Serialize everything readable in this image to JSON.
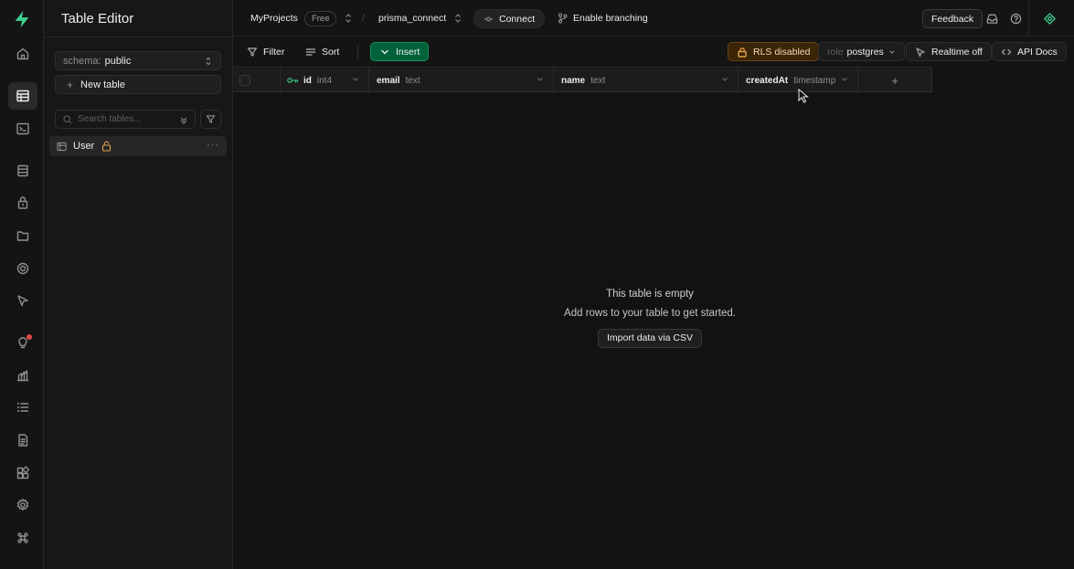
{
  "sidebar": {
    "title": "Table Editor",
    "schema_prefix": "schema:",
    "schema_value": "public",
    "new_table_label": "New table",
    "search_placeholder": "Search tables...",
    "tables": [
      {
        "name": "User",
        "rls_lock": true
      }
    ]
  },
  "header": {
    "org": "MyProjects",
    "plan_badge": "Free",
    "separator": "/",
    "project": "prisma_connect",
    "connect_label": "Connect",
    "branching_label": "Enable branching",
    "feedback_label": "Feedback"
  },
  "toolbar": {
    "filter_label": "Filter",
    "sort_label": "Sort",
    "insert_label": "Insert",
    "rls_label": "RLS disabled",
    "role_prefix": "role",
    "role_value": "postgres",
    "realtime_label": "Realtime off",
    "api_docs_label": "API Docs"
  },
  "grid": {
    "columns": [
      {
        "name": "id",
        "type": "int4",
        "primary_key": true
      },
      {
        "name": "email",
        "type": "text"
      },
      {
        "name": "name",
        "type": "text"
      },
      {
        "name": "createdAt",
        "type": "timestamp"
      }
    ],
    "add_column_label": "+"
  },
  "empty_state": {
    "title": "This table is empty",
    "subtitle": "Add rows to your table to get started.",
    "import_label": "Import data via CSV"
  },
  "colors": {
    "brand": "#3ecf8e",
    "insert_bg": "#006239",
    "rls_bg": "#3b2508",
    "notification_dot": "#e5484d"
  }
}
